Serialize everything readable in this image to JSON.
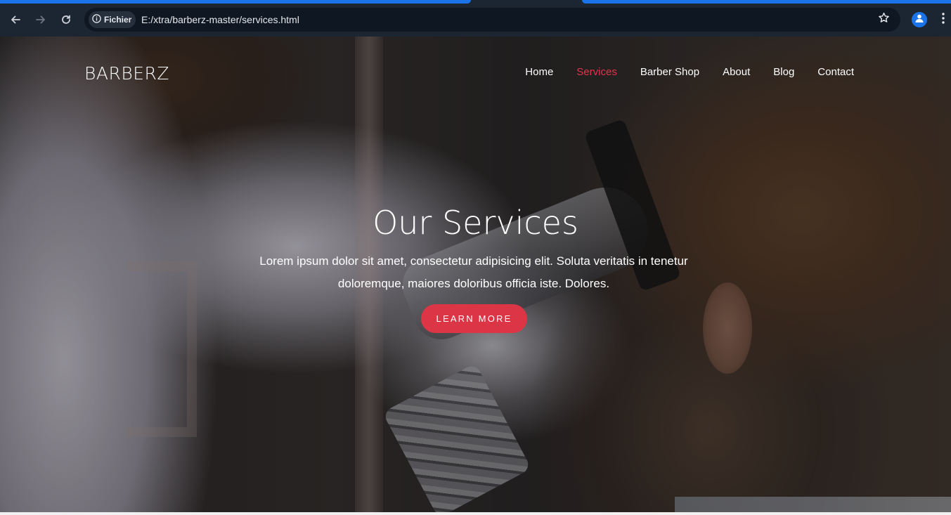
{
  "browser": {
    "site_chip_label": "Fichier",
    "url": "E:/xtra/barberz-master/services.html",
    "icons": {
      "back": "arrow-left-icon",
      "forward": "arrow-right-icon",
      "reload": "reload-icon",
      "info": "info-icon",
      "bookmark": "star-icon",
      "profile": "person-icon",
      "menu": "kebab-menu-icon"
    },
    "accent_color": "#1a73e8"
  },
  "site": {
    "brand": "BARBERZ",
    "nav": [
      {
        "label": "Home",
        "active": false
      },
      {
        "label": "Services",
        "active": true
      },
      {
        "label": "Barber Shop",
        "active": false
      },
      {
        "label": "About",
        "active": false
      },
      {
        "label": "Blog",
        "active": false
      },
      {
        "label": "Contact",
        "active": false
      }
    ],
    "active_color": "#e0354b"
  },
  "hero": {
    "title": "Our Services",
    "text": "Lorem ipsum dolor sit amet, consectetur adipisicing elit. Soluta veritatis in tenetur doloremque, maiores doloribus officia iste. Dolores.",
    "cta_label": "LEARN MORE",
    "cta_color": "#dc3545"
  }
}
